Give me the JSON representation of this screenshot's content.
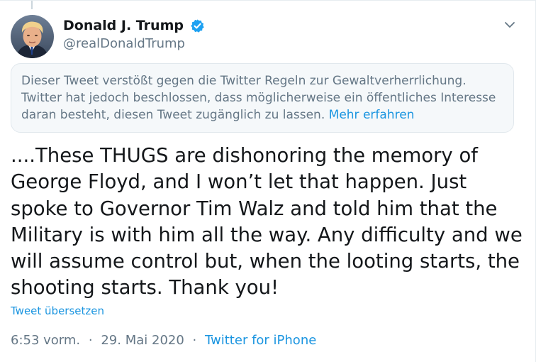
{
  "author": {
    "display_name": "Donald J. Trump",
    "handle": "@realDonaldTrump",
    "verified": true,
    "verified_color": "#1da1f2"
  },
  "icons": {
    "avatar": "avatar-portrait",
    "verified": "verified-badge-icon",
    "menu": "chevron-down-icon"
  },
  "notice": {
    "text": "Dieser Tweet verstößt gegen die Twitter Regeln zur Gewaltverherrlichung. Twitter hat jedoch beschlossen, dass möglicherweise ein öffentliches Interesse daran besteht, diesen Tweet zugänglich zu lassen.",
    "link_label": "Mehr erfahren"
  },
  "tweet": {
    "text": "....These THUGS are dishonoring the memory of George Floyd, and I won’t let that happen. Just spoke to Governor Tim Walz and told him that the Military is with him all the way. Any difficulty and we will assume control but, when the looting starts, the shooting starts. Thank you!",
    "translate_label": "Tweet übersetzen"
  },
  "meta": {
    "time": "6:53 vorm.",
    "date": "29. Mai 2020",
    "separator": "·",
    "source": "Twitter for iPhone"
  },
  "colors": {
    "link": "#1b95e0",
    "secondary_text": "#657786",
    "notice_background": "#f5f8fa"
  }
}
